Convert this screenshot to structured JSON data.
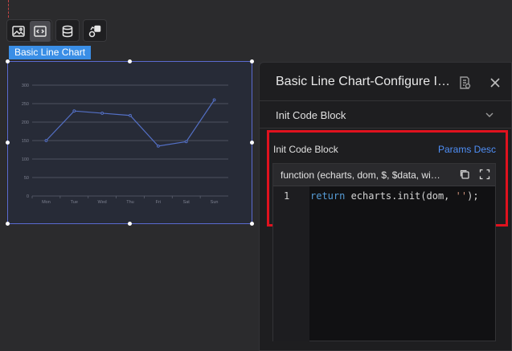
{
  "toolbar": {
    "buttons": [
      {
        "icon": "image-layer-icon",
        "active": false
      },
      {
        "icon": "code-layer-icon",
        "active": true
      },
      {
        "icon": "database-icon",
        "active": false
      },
      {
        "icon": "shapes-icon",
        "active": false
      }
    ]
  },
  "component": {
    "tag_label": "Basic Line Chart"
  },
  "chart_data": {
    "type": "line",
    "categories": [
      "Mon",
      "Tue",
      "Wed",
      "Thu",
      "Fri",
      "Sat",
      "Sun"
    ],
    "series": [
      {
        "values": [
          150,
          230,
          224,
          218,
          135,
          147,
          260
        ]
      }
    ],
    "yticks": [
      "0",
      "50",
      "100",
      "150",
      "200",
      "250",
      "300"
    ],
    "ylim": [
      0,
      300
    ],
    "grid": true,
    "colors": {
      "line": "#5470c6",
      "grid": "#5a5f6e",
      "axis_text": "#7d8190"
    }
  },
  "panel": {
    "title": "Basic Line Chart-Configure Items",
    "section_label": "Init Code Block",
    "init_label": "Init Code Block",
    "params_link": "Params Desc",
    "code_signature": "function (echarts, dom, $, $data, window)",
    "line_number": "1",
    "code": {
      "kw": "return",
      "mid": " echarts.init(dom, ",
      "str": "''",
      "end": ");"
    }
  }
}
